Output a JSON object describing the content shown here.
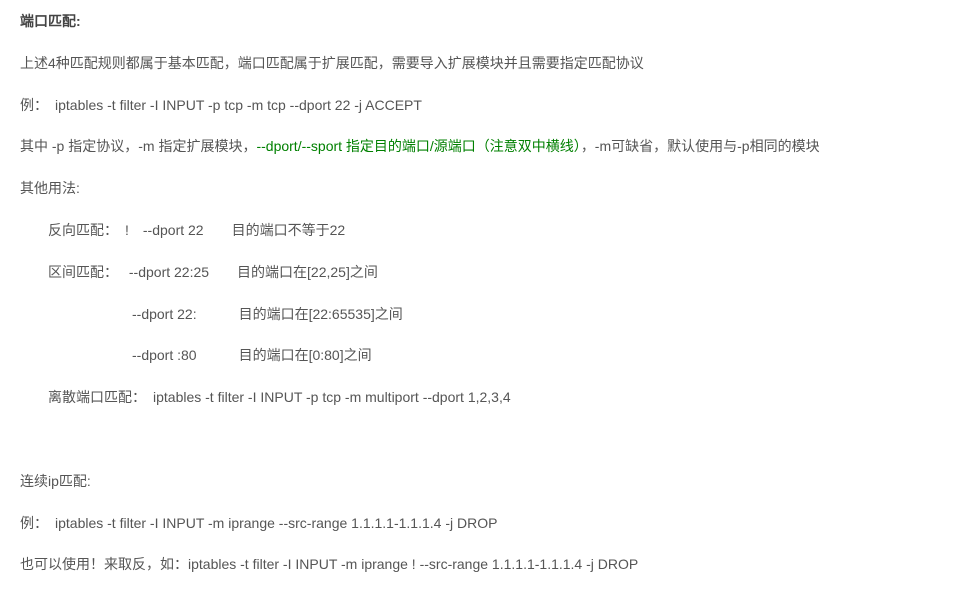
{
  "lines": {
    "l1": "端口匹配:",
    "l2": "上述4种匹配规则都属于基本匹配，端口匹配属于扩展匹配，需要导入扩展模块并且需要指定匹配协议",
    "l3": "例：　iptables -t filter -I INPUT -p tcp -m tcp --dport 22 -j ACCEPT",
    "l4a": "其中 -p 指定协议，-m 指定扩展模块，",
    "l4b": "--dport/--sport 指定目的端口/源端口（注意双中横线）",
    "l4c": "，-m可缺省，默认使用与-p相同的模块",
    "l5": "其他用法:",
    "l6": "反向匹配：　!　--dport 22　　目的端口不等于22",
    "l7": "区间匹配：　 --dport 22:25　　目的端口在[22,25]之间",
    "l8": "　　　　　　--dport 22:　　　目的端口在[22:65535]之间",
    "l9": "　　　　　　--dport :80　　　目的端口在[0:80]之间",
    "l10": "离散端口匹配：　iptables -t filter -I INPUT -p tcp -m multiport --dport 1,2,3,4",
    "l11": " ",
    "l12": "连续ip匹配:",
    "l13": "例：　iptables -t filter -I INPUT -m iprange --src-range 1.1.1.1-1.1.1.4 -j DROP",
    "l14": "也可以使用！来取反，如：iptables -t filter -I INPUT -m iprange ! --src-range 1.1.1.1-1.1.1.4 -j DROP"
  }
}
